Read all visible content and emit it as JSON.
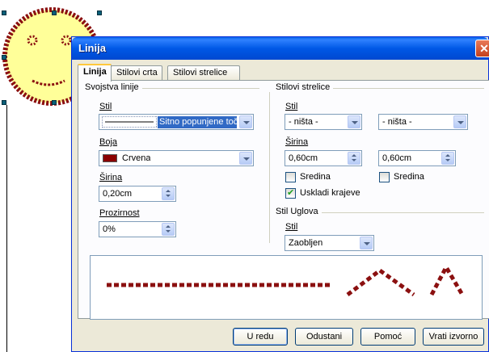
{
  "dialog": {
    "title": "Linija",
    "close_glyph": "✕"
  },
  "tabs": [
    {
      "label": "Linija"
    },
    {
      "label": "Stilovi crta"
    },
    {
      "label": "Stilovi strelice"
    }
  ],
  "line_properties": {
    "group_title": "Svojstva linije",
    "style_label": "Stil",
    "style_value": "Sitno popunjene točki",
    "color_label": "Boja",
    "color_value": "Crvena",
    "color_swatch": "#8b0000",
    "width_label": "Širina",
    "width_value": "0,20cm",
    "transparency_label": "Prozirnost",
    "transparency_value": "0%"
  },
  "arrow_styles": {
    "group_title": "Stilovi strelice",
    "style_label": "Stil",
    "start_style": "- ništa -",
    "end_style": "- ništa -",
    "width_label": "Širina",
    "start_width": "0,60cm",
    "end_width": "0,60cm",
    "start_center_label": "Sredina",
    "end_center_label": "Sredina",
    "sync_ends_label": "Uskladi krajeve",
    "sync_ends_checked": true
  },
  "corner_style": {
    "group_title": "Stil Uglova",
    "style_label": "Stil",
    "style_value": "Zaobljen"
  },
  "buttons": {
    "ok": "U redu",
    "cancel": "Odustani",
    "help": "Pomoć",
    "reset": "Vrati izvorno"
  },
  "colors": {
    "line_color": "#8b1010",
    "title_bar": "#0058e6"
  }
}
